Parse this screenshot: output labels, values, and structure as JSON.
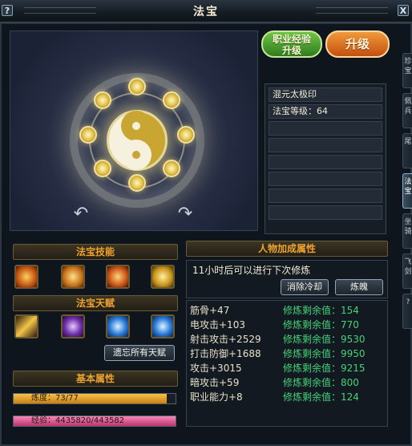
{
  "window": {
    "title": "法宝",
    "help_glyph": "?",
    "close_glyph": "X"
  },
  "side_tabs": [
    "珍宝",
    "佩兵",
    "尾",
    "法宝",
    "坐骑",
    "飞剑",
    "?"
  ],
  "artifact": {
    "name": "混元太极印",
    "level_text": "法宝等级：64",
    "rotate_left_glyph": "↶",
    "rotate_right_glyph": "↷"
  },
  "buttons": {
    "exp_upgrade_line1": "职业经验",
    "exp_upgrade_line2": "升级",
    "upgrade": "升级",
    "forget_talents": "遗忘所有天赋",
    "clear_cooldown": "消除冷却",
    "refine": "炼魄"
  },
  "sections": {
    "skills": "法宝技能",
    "talents": "法宝天赋",
    "basic": "基本属性",
    "char_bonus": "人物加成属性"
  },
  "skill_icons": [
    "warrior-glow-icon",
    "yin-yang-icon",
    "fire-figure-icon",
    "golden-figure-icon"
  ],
  "talent_icons": [
    "lightning-strike-icon",
    "purple-eye-icon",
    "blue-rune-icon",
    "blue-rune-icon"
  ],
  "basic_attrs": {
    "refine_label": "炼度：73/77",
    "refine_fraction": 0.948,
    "exp_label": "经验：4435820/443582",
    "exp_fraction": 1.0
  },
  "cooldown_text": "11小时后可以进行下次修炼",
  "char_attrs": [
    {
      "name": "筋骨+47",
      "remain": "修炼剩余值：154"
    },
    {
      "name": "电攻击+103",
      "remain": "修炼剩余值：770"
    },
    {
      "name": "射击攻击+2529",
      "remain": "修炼剩余值：9530"
    },
    {
      "name": "打击防御+1688",
      "remain": "修炼剩余值：9950"
    },
    {
      "name": "攻击+3015",
      "remain": "修炼剩余值：9215"
    },
    {
      "name": "暗攻击+59",
      "remain": "修炼剩余值：800"
    },
    {
      "name": "职业能力+8",
      "remain": "修炼剩余值：124"
    }
  ],
  "colors": {
    "section_title": "#f0a22e",
    "remain_green": "#48d27a",
    "refine_bar": "#e8a322",
    "exp_bar": "#e0559a"
  }
}
